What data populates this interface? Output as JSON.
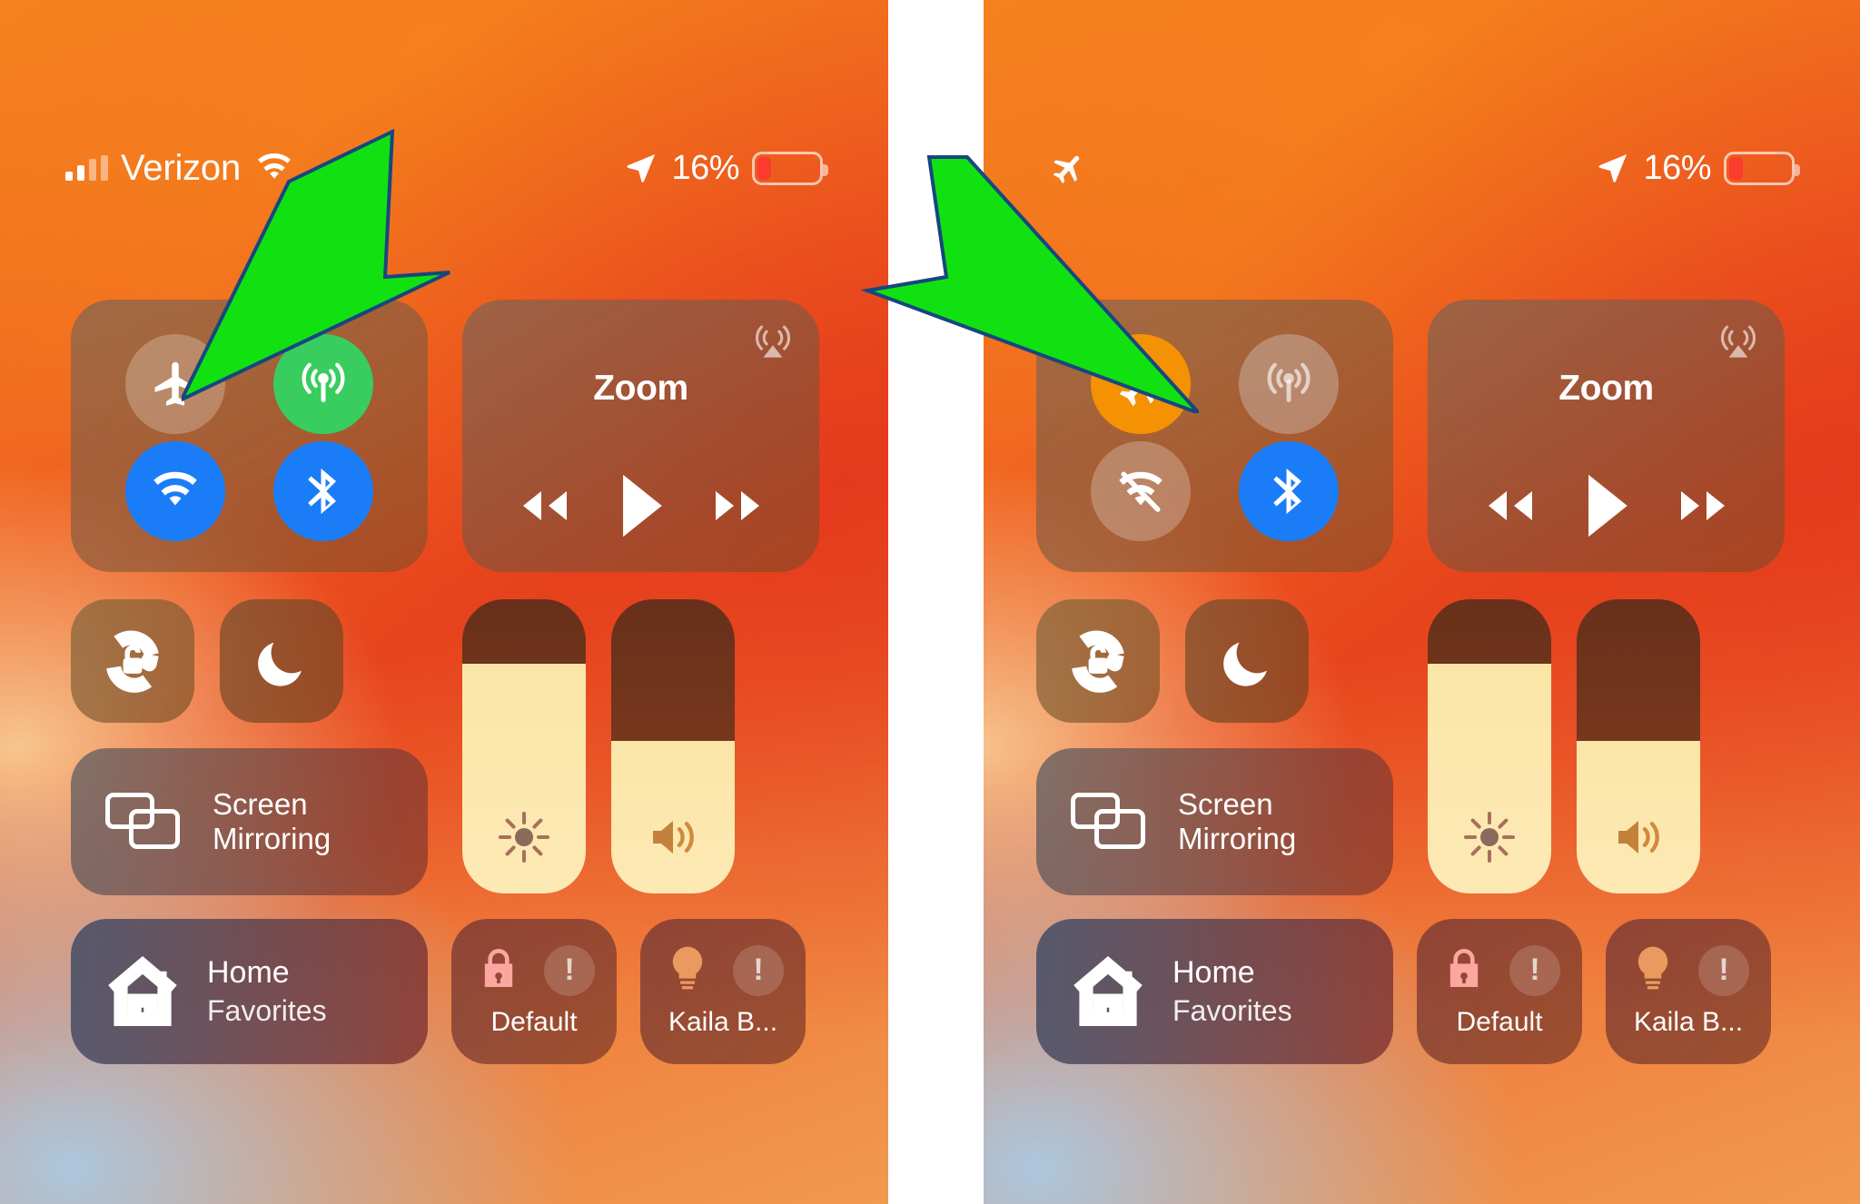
{
  "screenshot": {
    "kind": "ios-control-center-comparison",
    "panels": 2,
    "annotation_arrow_color": "#11e111",
    "annotation_arrow_outline": "#16477f"
  },
  "left_panel": {
    "caption": "airplane-mode-off-state",
    "status_bar": {
      "signal_icon": "cellular-bars-icon",
      "carrier": "Verizon",
      "wifi_icon": "wifi-icon",
      "location_icon": "location-arrow-icon",
      "battery_percent": "16%",
      "battery_level": 16,
      "battery_color": "#fb3b30"
    },
    "connectivity": {
      "airplane": {
        "label": "airplane-mode",
        "state": "off",
        "color": "rgba(235,225,215,.30)"
      },
      "cellular": {
        "label": "cellular-data",
        "state": "on",
        "color": "#39cc5f"
      },
      "wifi": {
        "label": "wi-fi",
        "state": "on",
        "color": "#1a7df7"
      },
      "bluetooth": {
        "label": "bluetooth",
        "state": "on",
        "color": "#1a7df7"
      }
    },
    "media": {
      "title": "Zoom",
      "airplay_icon": "airplay-audio-icon",
      "rewind": "rewind-button",
      "play": "play-button",
      "forward": "fast-forward-button"
    },
    "toggles": {
      "rotation_lock": "rotation-lock",
      "do_not_disturb": "do-not-disturb"
    },
    "screen_mirroring": {
      "line1": "Screen",
      "line2": "Mirroring"
    },
    "sliders": {
      "brightness": {
        "name": "brightness",
        "value": 78
      },
      "volume": {
        "name": "volume",
        "value": 52
      }
    },
    "home": {
      "title": "Home",
      "subtitle": "Favorites"
    },
    "accessories": [
      {
        "name": "Default",
        "icon": "lock-icon",
        "status": "warning"
      },
      {
        "name": "Kaila B...",
        "icon": "lightbulb-icon",
        "status": "warning"
      }
    ]
  },
  "right_panel": {
    "caption": "airplane-mode-on-state",
    "status_bar": {
      "airplane_icon": "airplane-icon",
      "location_icon": "location-arrow-icon",
      "battery_percent": "16%",
      "battery_level": 16,
      "battery_color": "#fb3b30"
    },
    "connectivity": {
      "airplane": {
        "label": "airplane-mode",
        "state": "on",
        "color": "#f59204"
      },
      "cellular": {
        "label": "cellular-data",
        "state": "off",
        "color": "rgba(220,220,220,.34)"
      },
      "wifi": {
        "label": "wi-fi",
        "state": "off",
        "color": "rgba(235,225,215,.30)"
      },
      "bluetooth": {
        "label": "bluetooth",
        "state": "on",
        "color": "#1a7df7"
      }
    },
    "media": {
      "title": "Zoom",
      "airplay_icon": "airplay-audio-icon",
      "rewind": "rewind-button",
      "play": "play-button",
      "forward": "fast-forward-button"
    },
    "toggles": {
      "rotation_lock": "rotation-lock",
      "do_not_disturb": "do-not-disturb"
    },
    "screen_mirroring": {
      "line1": "Screen",
      "line2": "Mirroring"
    },
    "sliders": {
      "brightness": {
        "name": "brightness",
        "value": 78
      },
      "volume": {
        "name": "volume",
        "value": 52
      }
    },
    "home": {
      "title": "Home",
      "subtitle": "Favorites"
    },
    "accessories": [
      {
        "name": "Default",
        "icon": "lock-icon",
        "status": "warning"
      },
      {
        "name": "Kaila B...",
        "icon": "lightbulb-icon",
        "status": "warning"
      }
    ]
  }
}
